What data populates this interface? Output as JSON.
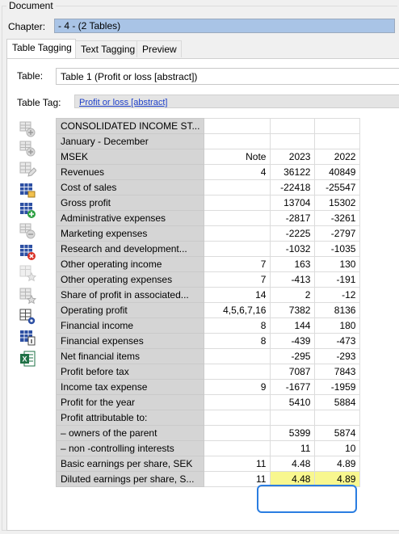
{
  "document": {
    "label": "Document"
  },
  "chapter": {
    "label": "Chapter:",
    "value": "- 4 - (2 Tables)"
  },
  "tabs": [
    {
      "label": "Table Tagging",
      "active": true
    },
    {
      "label": "Text Tagging",
      "active": false
    },
    {
      "label": "Preview",
      "active": false
    }
  ],
  "table_field": {
    "label": "Table:",
    "value": "Table 1 (Profit or loss [abstract])"
  },
  "tag_field": {
    "label": "Table Tag:",
    "value": "Profit or loss [abstract]"
  },
  "toolbar": {
    "items": [
      {
        "name": "add-row-icon",
        "enabled": false
      },
      {
        "name": "insert-column-icon",
        "enabled": false
      },
      {
        "name": "edit-table-icon",
        "enabled": false
      },
      {
        "name": "table-grid-icon",
        "enabled": true
      },
      {
        "name": "add-table-icon",
        "enabled": true
      },
      {
        "name": "remove-row-icon",
        "enabled": false
      },
      {
        "name": "delete-table-icon",
        "enabled": true
      },
      {
        "name": "tag-star-icon",
        "enabled": false
      },
      {
        "name": "table-star-icon",
        "enabled": false
      },
      {
        "name": "table-settings-icon",
        "enabled": true
      },
      {
        "name": "table-info-icon",
        "enabled": true
      },
      {
        "name": "excel-export-icon",
        "enabled": true
      }
    ]
  },
  "grid": {
    "rows": [
      [
        "CONSOLIDATED INCOME ST...",
        "",
        "",
        ""
      ],
      [
        "January - December",
        "",
        "",
        ""
      ],
      [
        "MSEK",
        "Note",
        "2023",
        "2022"
      ],
      [
        "Revenues",
        "4",
        "36122",
        "40849"
      ],
      [
        "Cost of sales",
        "",
        "-22418",
        "-25547"
      ],
      [
        "Gross profit",
        "",
        "13704",
        "15302"
      ],
      [
        "Administrative expenses",
        "",
        "-2817",
        "-3261"
      ],
      [
        "Marketing expenses",
        "",
        "-2225",
        "-2797"
      ],
      [
        "Research and development...",
        "",
        "-1032",
        "-1035"
      ],
      [
        "Other operating income",
        "7",
        "163",
        "130"
      ],
      [
        "Other operating expenses",
        "7",
        "-413",
        "-191"
      ],
      [
        "Share of profit in associated...",
        "14",
        "2",
        "-12"
      ],
      [
        "Operating profit",
        "4,5,6,7,16",
        "7382",
        "8136"
      ],
      [
        "Financial income",
        "8",
        "144",
        "180"
      ],
      [
        "Financial expenses",
        "8",
        "-439",
        "-473"
      ],
      [
        "Net financial items",
        "",
        "-295",
        "-293"
      ],
      [
        "Profit before tax",
        "",
        "7087",
        "7843"
      ],
      [
        "Income tax expense",
        "9",
        "-1677",
        "-1959"
      ],
      [
        "Profit for the year",
        "",
        "5410",
        "5884"
      ],
      [
        "Profit attributable to:",
        "",
        "",
        ""
      ],
      [
        "– owners of the parent",
        "",
        "5399",
        "5874"
      ],
      [
        "– non -controlling interests",
        "",
        "11",
        "10"
      ],
      [
        "Basic earnings per share, SEK",
        "11",
        "4.48",
        "4.89"
      ],
      [
        "Diluted earnings per share, S...",
        "11",
        "4.48",
        "4.89"
      ]
    ],
    "highlighted_row": 23,
    "highlight_color": "#f8f78f",
    "selection_color": "#2a7de1"
  }
}
